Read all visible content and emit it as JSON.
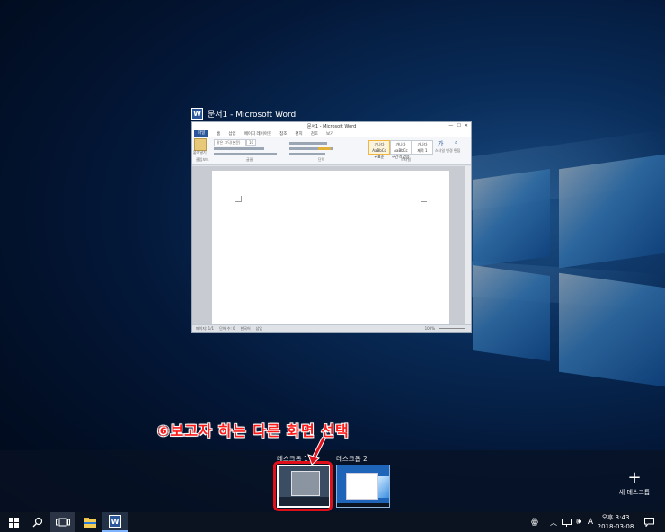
{
  "window": {
    "title": "문서1 - Microsoft Word",
    "icon_name": "word-icon",
    "word_titlebar": "문서1 - Microsoft Word",
    "ribbon_tabs": [
      "파일",
      "홈",
      "삽입",
      "페이지 레이아웃",
      "참조",
      "편지",
      "검토",
      "보기"
    ],
    "font_name": "맑은 고딕(본문)",
    "font_size": "10",
    "groups": [
      "클립보드",
      "글꼴",
      "단락",
      "스타일"
    ],
    "paste_label": "붙여넣기",
    "styles": [
      "가나다AaBbCc",
      "가나다AaBbCc",
      "가나다"
    ],
    "style_names": [
      "↵표준",
      "↵간격 없음",
      "제목 1"
    ],
    "change_styles_label": "스타일 변경",
    "edit_label": "편집",
    "status": [
      "페이지: 1/1",
      "단어 수: 0",
      "한국어",
      "삽입"
    ],
    "zoom": "100%"
  },
  "annotation": "⑥보고자 하는 다른 화면 선택",
  "virtual_desktops": [
    {
      "label": "데스크톱 1"
    },
    {
      "label": "데스크톱 2"
    }
  ],
  "new_desktop": {
    "label": "새 데스크톱",
    "icon": "plus-icon"
  },
  "taskbar": {
    "icons": [
      "windows-start-icon",
      "search-icon",
      "task-view-icon",
      "file-explorer-icon",
      "word-icon"
    ],
    "tray": {
      "ime": "A",
      "time": "오후 3:43",
      "date": "2018-03-08"
    }
  },
  "colors": {
    "accent_red": "#e0101b",
    "word_blue": "#2b579a",
    "taskbar": "#0c1320"
  }
}
